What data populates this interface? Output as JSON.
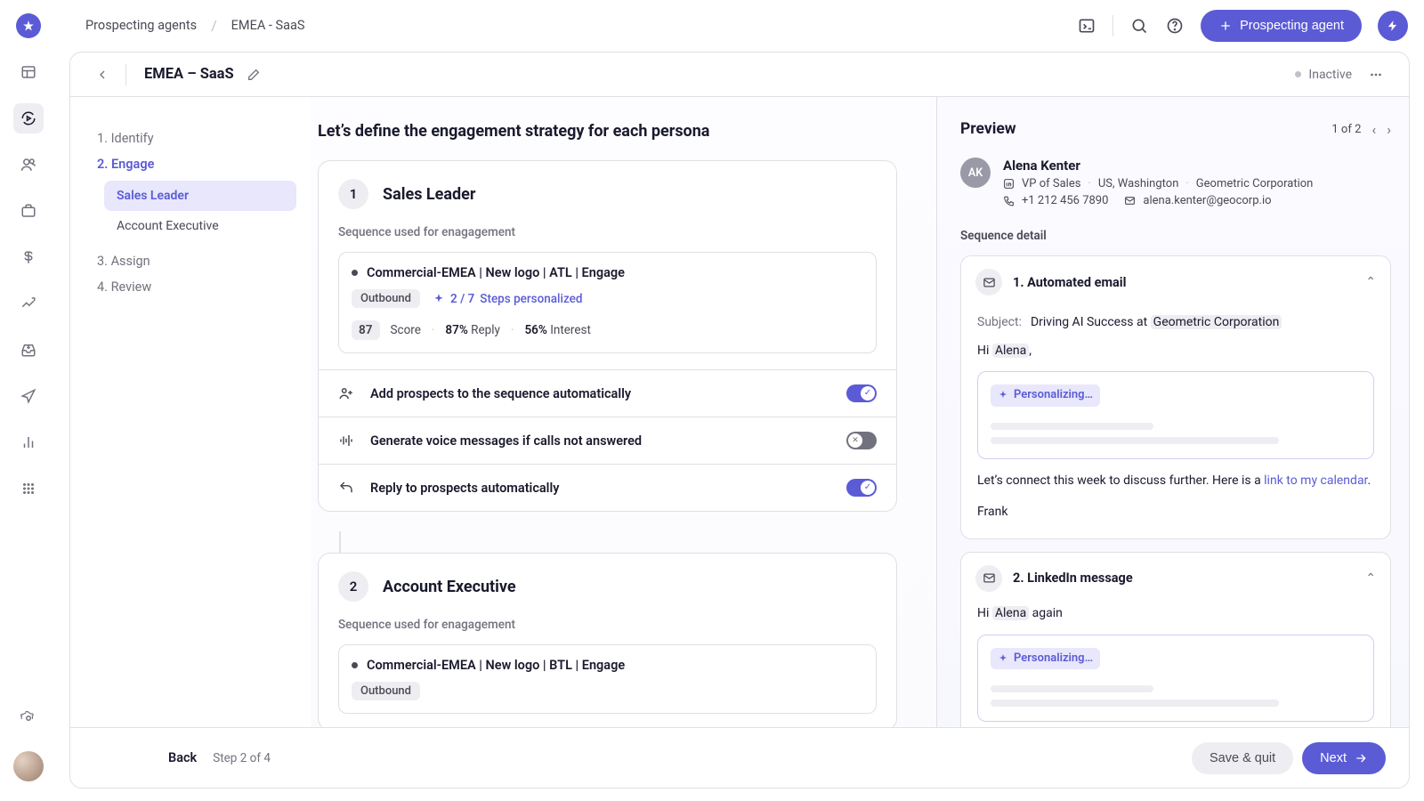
{
  "breadcrumb": {
    "root": "Prospecting agents",
    "current": "EMEA - SaaS"
  },
  "header": {
    "prospect_btn": "Prospecting agent"
  },
  "page": {
    "title": "EMEA – SaaS",
    "status": "Inactive"
  },
  "steps": {
    "s1": "1. Identify",
    "s2": "2. Engage",
    "s3": "3. Assign",
    "s4": "4. Review",
    "sub1": "Sales Leader",
    "sub2": "Account Executive"
  },
  "center": {
    "heading": "Let’s define the engagement strategy for each persona",
    "p1": {
      "num": "1",
      "name": "Sales Leader",
      "seq_label": "Sequence used for enagagement",
      "seq_name": "Commercial-EMEA | New logo | ATL | Engage",
      "chip": "Outbound",
      "steps_pers": "2 / 7",
      "steps_text": "Steps personalized",
      "score": "87",
      "score_label": "Score",
      "reply": "87%",
      "reply_label": "Reply",
      "interest": "56%",
      "interest_label": "Interest",
      "toggle_add": "Add prospects to the sequence automatically",
      "toggle_voice": "Generate voice messages if calls not answered",
      "toggle_reply": "Reply to prospects automatically"
    },
    "p2": {
      "num": "2",
      "name": "Account Executive",
      "seq_label": "Sequence used for enagagement",
      "seq_name": "Commercial-EMEA | New logo | BTL | Engage",
      "chip": "Outbound"
    }
  },
  "preview": {
    "title": "Preview",
    "pager": "1 of 2",
    "contact": {
      "initials": "AK",
      "name": "Alena Kenter",
      "title": "VP of Sales",
      "location": "US, Washington",
      "company": "Geometric Corporation",
      "phone": "+1 212 456 7890",
      "email": "alena.kenter@geocorp.io"
    },
    "section": "Sequence detail",
    "step1": {
      "title": "1. Automated email",
      "subject_label": "Subject:",
      "subject_pre": "Driving AI Success at ",
      "subject_hl": "Geometric Corporation",
      "greeting_pre": "Hi ",
      "greeting_name": "Alena",
      "pers": "Personalizing…",
      "followup_pre": "Let’s connect this week to discuss further. Here is a ",
      "followup_link": "link to my calendar",
      "sign": "Frank"
    },
    "step2": {
      "title": "2. LinkedIn message",
      "greeting_pre": "Hi ",
      "greeting_name": "Alena",
      "greeting_post": " again",
      "pers": "Personalizing…"
    }
  },
  "bottom": {
    "back": "Back",
    "step": "Step 2 of 4",
    "save": "Save & quit",
    "next": "Next"
  }
}
